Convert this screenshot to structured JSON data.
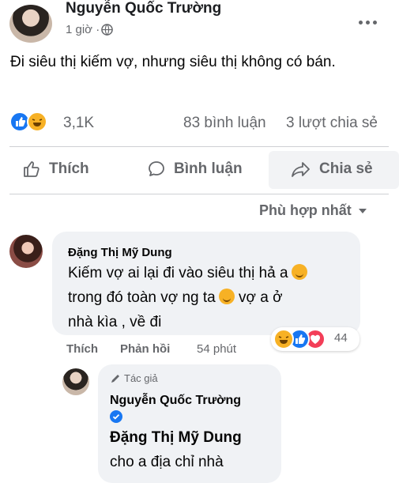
{
  "post": {
    "author": "Nguyễn Quốc Trường",
    "time": "1 giờ · ",
    "text": "Đi siêu thị kiếm vợ, nhưng siêu thị không có bán.",
    "reaction_count": "3,1K",
    "comments_count": "83 bình luận",
    "shares_count": "3 lượt chia sẻ"
  },
  "actions": {
    "like": "Thích",
    "comment": "Bình luận",
    "share": "Chia sẻ"
  },
  "sort": {
    "label": "Phù hợp nhất"
  },
  "comment1": {
    "author": "Đặng Thị Mỹ Dung",
    "line1": "Kiếm vợ ai lại đi vào siêu thị hả a",
    "line2a": "trong đó toàn vợ ng ta",
    "line2b": " vợ a ở",
    "line3": "nhà kìa , về đi",
    "like": "Thích",
    "reply": "Phản hồi",
    "time": "54 phút",
    "reaction_count": "44"
  },
  "reply1": {
    "badge": "Tác giả",
    "author": "Nguyễn Quốc Trường",
    "mention": "Đặng Thị Mỹ Dung",
    "text": "cho a địa chỉ nhà"
  },
  "colors": {
    "accent": "#1877f2",
    "bubble": "#f0f2f5",
    "secondary_text": "#65676b"
  }
}
